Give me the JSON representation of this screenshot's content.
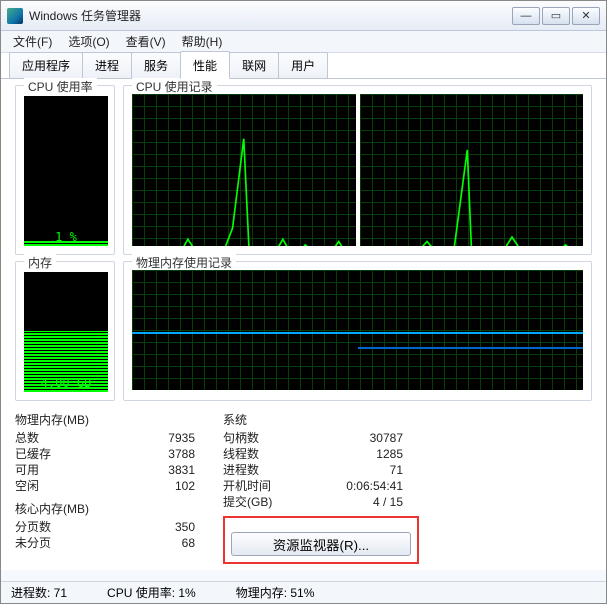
{
  "window": {
    "title": "Windows 任务管理器"
  },
  "menu": {
    "file": "文件(F)",
    "options": "选项(O)",
    "view": "查看(V)",
    "help": "帮助(H)"
  },
  "tabs": {
    "apps": "应用程序",
    "procs": "进程",
    "services": "服务",
    "perf": "性能",
    "net": "联网",
    "users": "用户"
  },
  "cpu": {
    "usage_label": "CPU 使用率",
    "history_label": "CPU 使用记录",
    "value": "1 %"
  },
  "mem": {
    "usage_label": "内存",
    "history_label": "物理内存使用记录",
    "value": "4.00 GB"
  },
  "phys": {
    "title": "物理内存(MB)",
    "total_l": "总数",
    "total_v": "7935",
    "cached_l": "已缓存",
    "cached_v": "3788",
    "avail_l": "可用",
    "avail_v": "3831",
    "free_l": "空闲",
    "free_v": "102"
  },
  "kernel": {
    "title": "核心内存(MB)",
    "paged_l": "分页数",
    "paged_v": "350",
    "nonpaged_l": "未分页",
    "nonpaged_v": "68"
  },
  "sys": {
    "title": "系统",
    "handles_l": "句柄数",
    "handles_v": "30787",
    "threads_l": "线程数",
    "threads_v": "1285",
    "procs_l": "进程数",
    "procs_v": "71",
    "uptime_l": "开机时间",
    "uptime_v": "0:06:54:41",
    "commit_l": "提交(GB)",
    "commit_v": "4 / 15"
  },
  "resmon": {
    "label": "资源监视器(R)..."
  },
  "status": {
    "procs": "进程数: 71",
    "cpu": "CPU 使用率: 1%",
    "mem": "物理内存: 51%"
  }
}
